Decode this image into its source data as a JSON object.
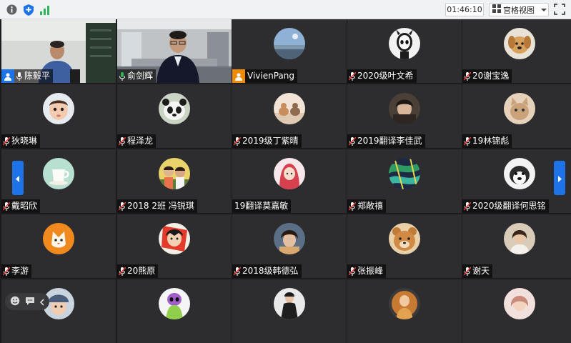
{
  "toolbar": {
    "time": "01:46:10",
    "view_label": "宫格视图",
    "icons": [
      "info-icon",
      "shield-icon",
      "signal-icon",
      "grid-view-icon",
      "chevron-down-icon",
      "fullscreen-icon"
    ],
    "colors": {
      "shield": "#1a73e8",
      "signal": "#2fb45b"
    }
  },
  "participants": [
    {
      "name": "陈毅平",
      "type": "video",
      "host": true,
      "mic_on": true
    },
    {
      "name": "俞剑辉",
      "type": "video",
      "mic_on": true,
      "active_speaker": true
    },
    {
      "name": "VivienPang",
      "type": "avatar",
      "host": true,
      "avatar": "landscape"
    },
    {
      "name": "2020级叶文希",
      "type": "avatar",
      "muted": true,
      "avatar": "knight"
    },
    {
      "name": "20谢宝逸",
      "type": "avatar",
      "muted": true,
      "avatar": "dog"
    },
    {
      "name": "狄晓琳",
      "type": "avatar",
      "muted": true,
      "avatar": "baby"
    },
    {
      "name": "程泽龙",
      "type": "avatar",
      "muted": true,
      "avatar": "panda"
    },
    {
      "name": "2019级丁紫晴",
      "type": "avatar",
      "muted": true,
      "avatar": "cats"
    },
    {
      "name": "2019翻译李佳武",
      "type": "avatar",
      "muted": true,
      "avatar": "portrait-dark"
    },
    {
      "name": "19林锦彪",
      "type": "avatar",
      "muted": true,
      "avatar": "cat-tan"
    },
    {
      "name": "戴昭欣",
      "type": "avatar",
      "muted": true,
      "avatar": "cup"
    },
    {
      "name": "2018 2班 冯锐琪",
      "type": "avatar",
      "muted": true,
      "avatar": "kids"
    },
    {
      "name": "19翻译莫嘉敏",
      "type": "avatar",
      "avatar": "girl-red"
    },
    {
      "name": "郑敞禧",
      "type": "avatar",
      "muted": true,
      "avatar": "leaves"
    },
    {
      "name": "2020级翻译何思铭",
      "type": "avatar",
      "muted": true,
      "avatar": "husky"
    },
    {
      "name": "李游",
      "type": "avatar",
      "muted": true,
      "avatar": "fox"
    },
    {
      "name": "20熊原",
      "type": "avatar",
      "muted": true,
      "avatar": "anime-red"
    },
    {
      "name": "2018级韩德弘",
      "type": "avatar",
      "muted": true,
      "avatar": "dark-hair"
    },
    {
      "name": "张振峰",
      "type": "avatar",
      "muted": true,
      "avatar": "bear"
    },
    {
      "name": "谢天",
      "type": "avatar",
      "muted": true,
      "avatar": "woman"
    },
    {
      "name": "",
      "type": "avatar",
      "avatar": "child-cap"
    },
    {
      "name": "",
      "type": "avatar",
      "avatar": "alien"
    },
    {
      "name": "",
      "type": "avatar",
      "avatar": "man-suit"
    },
    {
      "name": "",
      "type": "avatar",
      "avatar": "orange-figure"
    },
    {
      "name": "",
      "type": "avatar",
      "avatar": "bright-photo"
    },
    {
      "name": "",
      "type": "avatar",
      "avatar": "pink-girl"
    }
  ],
  "navigation": {
    "prev_icon": "chevron-left-icon",
    "next_icon": "chevron-right-icon"
  },
  "bottom_bar": {
    "icons": [
      "emoji-icon",
      "chat-icon",
      "chevron-left-icon"
    ]
  }
}
